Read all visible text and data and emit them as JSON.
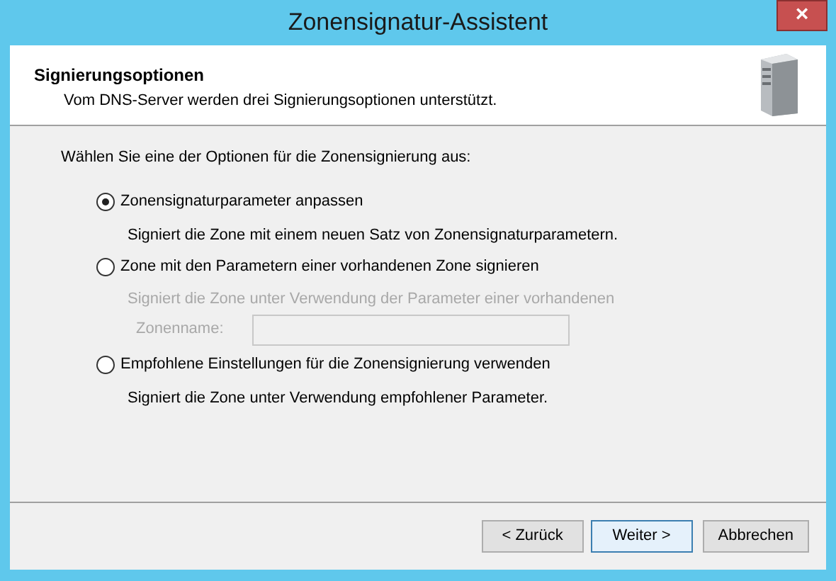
{
  "window": {
    "title": "Zonensignatur-Assistent",
    "close": "×"
  },
  "header": {
    "title": "Signierungsoptionen",
    "subtitle": "Vom DNS-Server werden drei Signierungsoptionen unterstützt."
  },
  "prompt": "Wählen Sie eine der Optionen für die Zonensignierung aus:",
  "options": [
    {
      "label": "Zonensignaturparameter anpassen",
      "selected": true,
      "disabled": false,
      "description": "Signiert die Zone mit einem neuen Satz von Zonensignaturparametern."
    },
    {
      "label": "Zone mit den Parametern einer vorhandenen Zone signieren",
      "selected": false,
      "disabled": true,
      "description": "Signiert die Zone unter Verwendung der Parameter einer vorhandenen",
      "field": {
        "label": "Zonenname:"
      }
    },
    {
      "label": "Empfohlene Einstellungen für die Zonensignierung verwenden",
      "selected": false,
      "disabled": false,
      "description": "Signiert die Zone unter Verwendung empfohlener Parameter."
    }
  ],
  "buttons": [
    {
      "label": "< Zurück",
      "default": false
    },
    {
      "label": "Weiter >",
      "default": true
    },
    {
      "label": "Abbrechen",
      "default": false
    }
  ]
}
